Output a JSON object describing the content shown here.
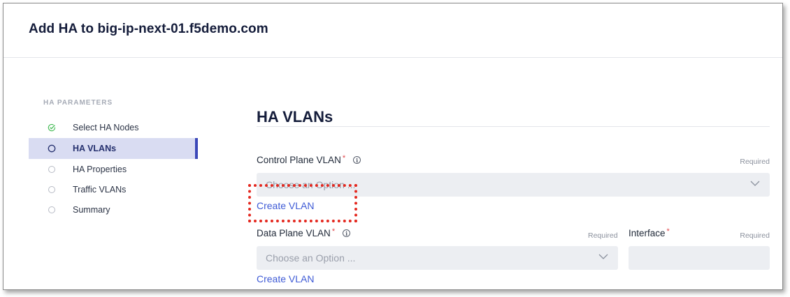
{
  "dialog": {
    "title": "Add HA to big-ip-next-01.f5demo.com"
  },
  "sidebar": {
    "heading": "HA PARAMETERS",
    "steps": [
      {
        "label": "Select HA Nodes",
        "state": "completed",
        "icon": "check-circle-icon"
      },
      {
        "label": "HA VLANs",
        "state": "active",
        "icon": "circle-icon"
      },
      {
        "label": "HA Properties",
        "state": "pending",
        "icon": "circle-icon"
      },
      {
        "label": "Traffic VLANs",
        "state": "pending",
        "icon": "circle-icon"
      },
      {
        "label": "Summary",
        "state": "pending",
        "icon": "circle-icon"
      }
    ]
  },
  "main": {
    "title": "HA VLANs",
    "control_plane": {
      "label": "Control Plane VLAN",
      "required_marker": "*",
      "required_note": "Required",
      "placeholder": "Choose an Option ...",
      "create_link": "Create VLAN"
    },
    "data_plane": {
      "label": "Data Plane VLAN",
      "required_marker": "*",
      "required_note": "Required",
      "placeholder": "Choose an Option ...",
      "create_link": "Create VLAN"
    },
    "interface": {
      "label": "Interface",
      "required_marker": "*",
      "required_note": "Required",
      "value": ""
    }
  },
  "colors": {
    "accent": "#3b47b8",
    "active_bg": "#d9dcf2",
    "link": "#3f5bd6",
    "success": "#3fb950",
    "required": "#e0454a",
    "highlight": "#e4281f"
  }
}
